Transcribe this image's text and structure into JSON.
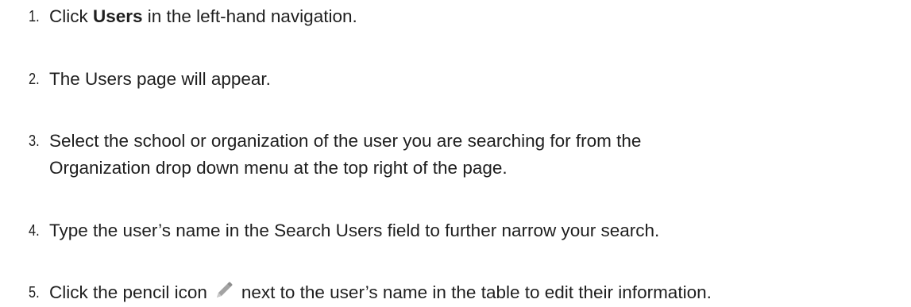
{
  "steps": [
    {
      "number": "1.",
      "before": "Click ",
      "bold": "Users",
      "after": " in the left-hand navigation."
    },
    {
      "number": "2.",
      "text": "The Users page will appear."
    },
    {
      "number": "3.",
      "line1": "Select the school or organization of the user you are searching for from the",
      "line2": "Organization drop down menu at the top right of the page."
    },
    {
      "number": "4.",
      "text": "Type the user’s name in the Search Users field to further narrow your search."
    },
    {
      "number": "5.",
      "before": "Click the pencil icon",
      "icon": "pencil-icon",
      "after": "next to the user’s name in the table to edit their information."
    }
  ],
  "colors": {
    "text": "#1f1f1f",
    "icon": "#9b9b9b"
  }
}
